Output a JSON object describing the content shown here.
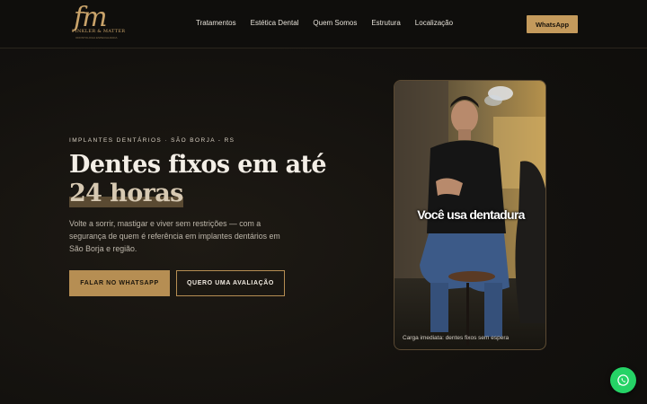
{
  "brand": {
    "monogram": "fm",
    "name": "FINKLER & MATTER",
    "tagline": "ODONTOLOGIA ESPECIALIZADA"
  },
  "nav": {
    "items": [
      "Tratamentos",
      "Estética Dental",
      "Quem Somos",
      "Estrutura",
      "Localização"
    ]
  },
  "header": {
    "whatsapp_label": "WhatsApp"
  },
  "hero": {
    "eyebrow": "IMPLANTES DENTÁRIOS · SÃO BORJA - RS",
    "headline_part1": "Dentes fixos em até ",
    "headline_highlight": "24 horas",
    "subtitle": "Volte a sorrir, mastigar e viver sem restrições — com a segurança de quem é referência em implantes dentários em São Borja e região.",
    "primary_cta": "FALAR NO WHATSAPP",
    "secondary_cta": "QUERO UMA AVALIAÇÃO"
  },
  "video": {
    "caption": "Você usa dentadura",
    "footer": "Carga imediata: dentes fixos sem espera"
  },
  "colors": {
    "accent": "#c49a5c",
    "background": "#13110e",
    "whatsapp_green": "#25d366"
  },
  "icons": {
    "fab": "whatsapp-icon"
  }
}
